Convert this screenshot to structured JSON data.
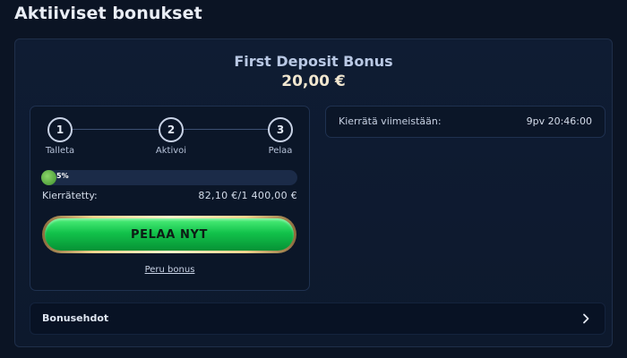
{
  "page": {
    "title": "Aktiiviset bonukset"
  },
  "bonus": {
    "name": "First Deposit Bonus",
    "amount": "20,00 €"
  },
  "steps": [
    {
      "number": "1",
      "label": "Talleta"
    },
    {
      "number": "2",
      "label": "Aktivoi"
    },
    {
      "number": "3",
      "label": "Pelaa"
    }
  ],
  "progress": {
    "percent_text": "5%",
    "fraction": 0.05
  },
  "wager": {
    "label": "Kierrätetty:",
    "value": "82,10  €/1 400,00  €"
  },
  "actions": {
    "play_label": "PELAA NYT",
    "cancel_label": "Peru bonus"
  },
  "deadline": {
    "label": "Kierrätä viimeistään:",
    "value": "9pv 20:46:00"
  },
  "terms": {
    "label": "Bonusehdot",
    "icon": "chevron-right-icon"
  },
  "colors": {
    "background": "#0b1424",
    "play_button": "#12c24b",
    "progress_fill": "#5fb43f",
    "gold_border": "#f0d38e"
  }
}
